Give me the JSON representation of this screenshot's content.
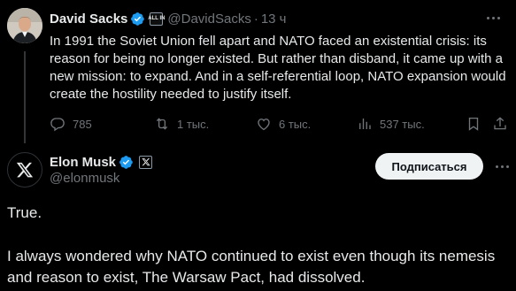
{
  "parent_tweet": {
    "author_name": "David Sacks",
    "handle": "@DavidSacks",
    "separator": "·",
    "time": "13 ч",
    "affiliate_badge_text": "ALL IN",
    "text": "In 1991 the Soviet Union fell apart and NATO faced an existential crisis: its reason for being no longer existed. But rather than disband, it came up with a new mission: to expand. And in a self-referential loop, NATO expansion would create the hostility needed to justify itself.",
    "actions": {
      "replies": "785",
      "retweets": "1 тыс.",
      "likes": "6 тыс.",
      "views": "537 тыс."
    }
  },
  "main_tweet": {
    "author_name": "Elon Musk",
    "handle": "@elonmusk",
    "subscribe_label": "Подписаться",
    "text_line_1": "True.",
    "text_line_2": "I always wondered why NATO continued to exist even though its nemesis and reason to exist, The Warsaw Pact, had dissolved."
  },
  "colors": {
    "background": "#000000",
    "text": "#e7e9ea",
    "muted": "#71767b",
    "verified_blue": "#1d9bf0",
    "button_bg": "#eff3f4"
  },
  "icons": {
    "verified": "verified-badge-icon",
    "reply": "reply-icon",
    "retweet": "retweet-icon",
    "like": "heart-icon",
    "views": "views-chart-icon",
    "bookmark": "bookmark-icon",
    "share": "share-icon",
    "more": "more-dots-icon",
    "x_logo": "x-logo-icon"
  }
}
